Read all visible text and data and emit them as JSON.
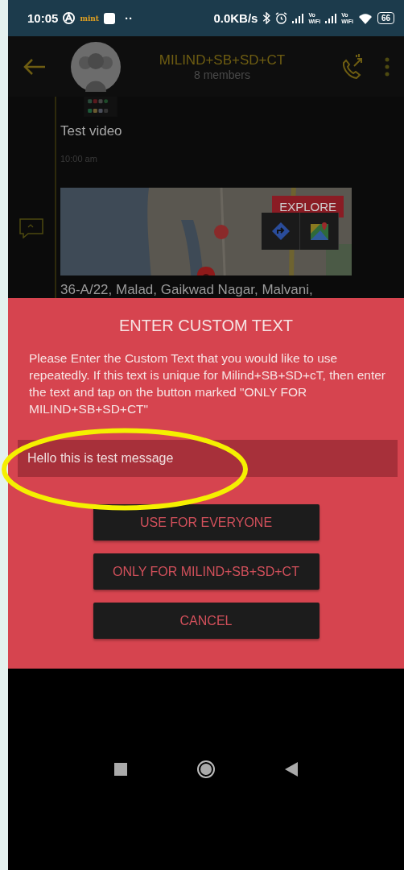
{
  "status_bar": {
    "time": "10:05",
    "logo": "mint",
    "more": "··",
    "speed": "0.0KB/s",
    "vowifi": [
      {
        "top": "Vo",
        "bottom": "WiFi"
      },
      {
        "top": "Vo",
        "bottom": "WiFi"
      }
    ],
    "battery": "66"
  },
  "header": {
    "title": "MILIND+SB+SD+CT",
    "subtitle": "8 members"
  },
  "messages": [
    {
      "kind": "video",
      "caption": "Test video",
      "time": "10:00 am"
    },
    {
      "kind": "location",
      "button": "EXPLORE",
      "address": "36-A/22, Malad, Gaikwad Nagar, Malvani,"
    }
  ],
  "dialog": {
    "title": "ENTER CUSTOM TEXT",
    "body": "Please Enter the Custom Text that you would like to use repeatedly. If this text is unique for Milind+SB+SD+cT, then enter the text and tap on the button marked \"ONLY FOR MILIND+SB+SD+CT\"",
    "value": "Hello this is test message",
    "buttons": [
      "USE FOR EVERYONE",
      "ONLY FOR MILIND+SB+SD+CT",
      "CANCEL"
    ]
  }
}
